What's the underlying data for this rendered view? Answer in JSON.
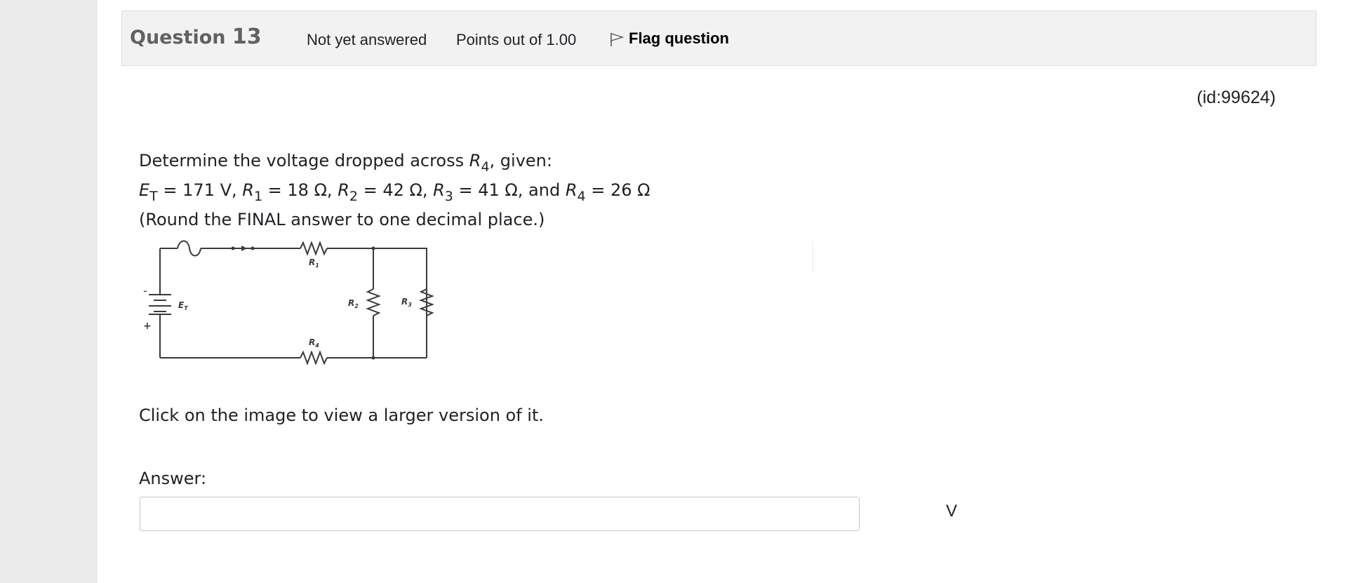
{
  "question": {
    "label": "Question",
    "number": "13",
    "state": "Not yet answered",
    "grade": "Points out of 1.00",
    "flag_label": "Flag question",
    "id": "(id:99624)"
  },
  "text": {
    "line1_pre": "Determine the voltage dropped across ",
    "line1_var": "R",
    "line1_sub": "4",
    "line1_post": ", given:",
    "et_var": "E",
    "et_sub": "T",
    "et_val": " = 171 V, ",
    "r1_var": "R",
    "r1_sub": "1",
    "r1_val": " = 18 Ω, ",
    "r2_var": "R",
    "r2_sub": "2",
    "r2_val": " = 42 Ω, ",
    "r3_var": "R",
    "r3_sub": "3",
    "r3_val": " = 41 Ω, and ",
    "r4_var": "R",
    "r4_sub": "4",
    "r4_val": " = 26 Ω",
    "round_note": "(Round the FINAL answer to one decimal place.)",
    "enlarge_note": "Click on the image to view a larger version of it."
  },
  "circuit": {
    "et_label": "E",
    "et_sub": "T",
    "r1_label": "R",
    "r1_sub": "1",
    "r2_label": "R",
    "r2_sub": "2",
    "r3_label": "R",
    "r3_sub": "3",
    "r4_label": "R",
    "r4_sub": "4",
    "minus_sign": "-",
    "plus_sign": "+"
  },
  "answer": {
    "label": "Answer:",
    "value": "",
    "unit": "V"
  },
  "icons": {
    "flag": "flag-outline-icon"
  }
}
